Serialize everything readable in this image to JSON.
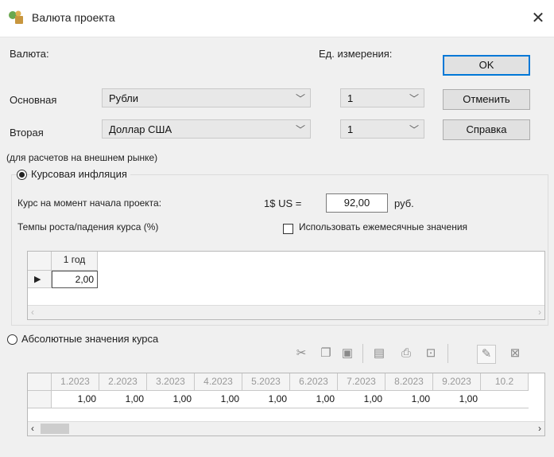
{
  "window": {
    "title": "Валюта проекта",
    "close_glyph": "✕"
  },
  "labels": {
    "currency": "Валюта:",
    "units": "Ед. измерения:",
    "primary": "Основная",
    "secondary": "Вторая",
    "note": "(для расчетов на внешнем рынке)"
  },
  "primary_currency": {
    "value": "Рубли",
    "unit": "1"
  },
  "secondary_currency": {
    "value": "Доллар США",
    "unit": "1"
  },
  "buttons": {
    "ok": "OK",
    "cancel": "Отменить",
    "help": "Справка"
  },
  "inflation": {
    "radio_label": "Курсовая инфляция",
    "selected": true,
    "rate_label": "Курс на момент начала проекта:",
    "rate_prefix": "1$ US =",
    "rate_value": "92,00",
    "rate_unit": "руб.",
    "growth_label": "Темпы роста/падения курса (%)",
    "monthly_checkbox": "Использовать ежемесячные значения",
    "monthly_checked": false,
    "table": {
      "header": "1 год",
      "value": "2,00"
    }
  },
  "absolute": {
    "radio_label": "Абсолютные значения курса",
    "selected": false,
    "columns": [
      "1.2023",
      "2.2023",
      "3.2023",
      "4.2023",
      "5.2023",
      "6.2023",
      "7.2023",
      "8.2023",
      "9.2023",
      "10.2"
    ],
    "values": [
      "1,00",
      "1,00",
      "1,00",
      "1,00",
      "1,00",
      "1,00",
      "1,00",
      "1,00",
      "1,00",
      ""
    ]
  },
  "toolbar_icons": [
    "cut-icon",
    "copy-icon",
    "paste-icon",
    "save-icon",
    "print-icon",
    "export-icon",
    "edit-icon",
    "excel-icon"
  ],
  "colors": {
    "accent": "#0078d7",
    "window_bg": "#f0f0f0"
  }
}
